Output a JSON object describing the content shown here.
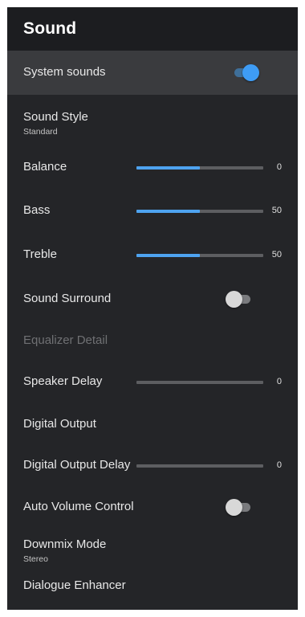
{
  "header": {
    "title": "Sound"
  },
  "rows": [
    {
      "label": "System sounds",
      "toggle": true
    },
    {
      "label": "Sound Style",
      "sub": "Standard"
    },
    {
      "label": "Balance",
      "value": "0",
      "fill": 0.5
    },
    {
      "label": "Bass",
      "value": "50",
      "fill": 0.5
    },
    {
      "label": "Treble",
      "value": "50",
      "fill": 0.5
    },
    {
      "label": "Sound Surround",
      "toggle": false
    },
    {
      "label": "Equalizer Detail",
      "disabled": true
    },
    {
      "label": "Speaker Delay",
      "value": "0",
      "fill": 0
    },
    {
      "label": "Digital Output"
    },
    {
      "label": "Digital Output Delay",
      "value": "0",
      "fill": 0
    },
    {
      "label": "Auto Volume Control",
      "toggle": false
    },
    {
      "label": "Downmix Mode",
      "sub": "Stereo"
    },
    {
      "label": "Dialogue Enhancer"
    }
  ],
  "colors": {
    "accent": "#3e9cf5",
    "background": "#242528",
    "header_background": "#1c1d20",
    "highlight": "#3a3b3e"
  }
}
